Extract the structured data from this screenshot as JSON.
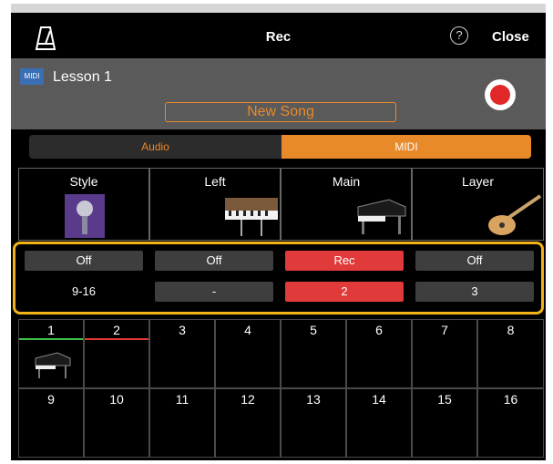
{
  "header": {
    "title": "Rec",
    "close_label": "Close",
    "help_symbol": "?"
  },
  "song": {
    "badge": "MIDI",
    "lesson_name": "Lesson 1",
    "new_song_label": "New Song"
  },
  "mode": {
    "audio_label": "Audio",
    "midi_label": "MIDI",
    "selected": "MIDI"
  },
  "parts": [
    {
      "label": "Style",
      "icon": "microphone-icon"
    },
    {
      "label": "Left",
      "icon": "keyboard-icon"
    },
    {
      "label": "Main",
      "icon": "grand-piano-icon"
    },
    {
      "label": "Layer",
      "icon": "guitar-icon"
    }
  ],
  "part_controls": [
    {
      "state": "Off",
      "channel": "9-16"
    },
    {
      "state": "Off",
      "channel": "-"
    },
    {
      "state": "Rec",
      "channel": "2"
    },
    {
      "state": "Off",
      "channel": "3"
    }
  ],
  "channels": [
    "1",
    "2",
    "3",
    "4",
    "5",
    "6",
    "7",
    "8",
    "9",
    "10",
    "11",
    "12",
    "13",
    "14",
    "15",
    "16"
  ],
  "colors": {
    "accent": "#e8892a",
    "record": "#e02828",
    "highlight": "#f2b318",
    "channel1": "#3ec24a",
    "channel2": "#e03a3a"
  }
}
